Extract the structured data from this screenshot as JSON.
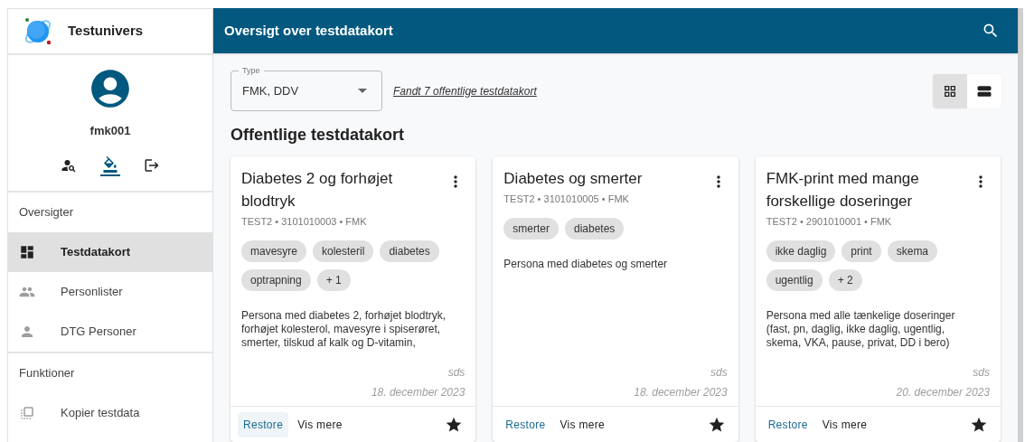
{
  "app": {
    "name": "Testunivers"
  },
  "profile": {
    "username": "fmk001",
    "actions": [
      {
        "kind": "person-search",
        "selected": false
      },
      {
        "kind": "theme",
        "selected": true
      },
      {
        "kind": "logout",
        "selected": false
      }
    ]
  },
  "sidebar": {
    "sections": [
      {
        "title": "Oversigter",
        "items": [
          {
            "label": "Testdatakort",
            "kind": "dashboard",
            "selected": true
          },
          {
            "label": "Personlister",
            "kind": "people",
            "selected": false
          },
          {
            "label": "DTG Personer",
            "kind": "person",
            "selected": false
          }
        ]
      },
      {
        "title": "Funktioner",
        "items": [
          {
            "label": "Kopier testdata",
            "kind": "copy",
            "selected": false
          }
        ]
      }
    ]
  },
  "header": {
    "title": "Oversigt over testdatakort"
  },
  "filter": {
    "label": "Type",
    "value": "FMK, DDV",
    "result_link": "Fandt 7 offentlige testdatakort"
  },
  "view_toggle": [
    {
      "kind": "grid",
      "selected": true
    },
    {
      "kind": "list",
      "selected": false
    }
  ],
  "section_title": "Offentlige testdatakort",
  "cards": [
    {
      "title": "Diabetes 2 og forhøjet blodtryk",
      "subtitle": "TEST2 • 3101010003 • FMK",
      "tags": [
        "mavesyre",
        "kolesteril",
        "diabetes",
        "optrapning",
        "+ 1"
      ],
      "description": "Persona med diabetes 2, forhøjet blodtryk, forhøjet kolesterol, mavesyre i spiserøret, smerter, tilskud af kalk og D-vitamin,",
      "author": "sds",
      "date": "18. december 2023",
      "actions": [
        {
          "label": "Restore",
          "kind": "primary",
          "hovered": true
        },
        {
          "label": "Vis mere",
          "kind": "secondary",
          "hovered": false
        }
      ],
      "favorite": true
    },
    {
      "title": "Diabetes og smerter",
      "subtitle": "TEST2 • 3101010005 • FMK",
      "tags": [
        "smerter",
        "diabetes"
      ],
      "description": "Persona med diabetes og smerter",
      "author": "sds",
      "date": "18. december 2023",
      "actions": [
        {
          "label": "Restore",
          "kind": "primary",
          "hovered": false
        },
        {
          "label": "Vis mere",
          "kind": "secondary",
          "hovered": false
        }
      ],
      "favorite": true
    },
    {
      "title": "FMK-print med mange forskellige doseringer",
      "subtitle": "TEST2 • 2901010001 • FMK",
      "tags": [
        "ikke daglig",
        "print",
        "skema",
        "ugentlig",
        "+ 2"
      ],
      "description": "Persona med alle tænkelige doseringer (fast, pn, daglig, ikke daglig, ugentlig, skema, VKA, pause, privat, DD i bero)",
      "author": "sds",
      "date": "20. december 2023",
      "actions": [
        {
          "label": "Restore",
          "kind": "primary",
          "hovered": false
        },
        {
          "label": "Vis mere",
          "kind": "secondary",
          "hovered": false
        }
      ],
      "favorite": true
    }
  ]
}
